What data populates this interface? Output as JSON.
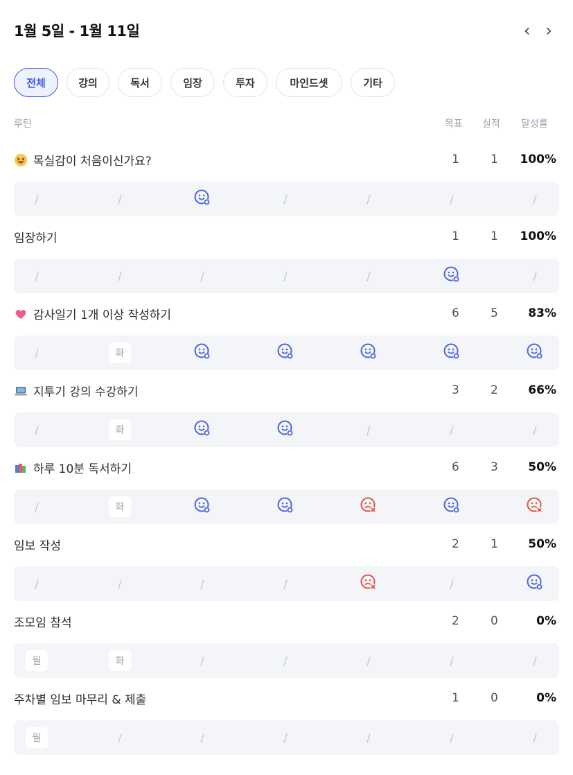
{
  "header": {
    "title": "1월 5일 - 1월 11일",
    "prev": "‹",
    "next": "›"
  },
  "tabs": [
    {
      "label": "전체",
      "active": true
    },
    {
      "label": "강의"
    },
    {
      "label": "독서"
    },
    {
      "label": "임장"
    },
    {
      "label": "투자"
    },
    {
      "label": "마인드셋"
    },
    {
      "label": "기타"
    }
  ],
  "columns": {
    "routine": "루틴",
    "goal": "목표",
    "actual": "실적",
    "rate": "달성률"
  },
  "routines": [
    {
      "emoji": "grinning-squint-face",
      "name": "목실감이 처음이신가요?",
      "goal": "1",
      "actual": "1",
      "rate": "100%",
      "days": [
        "/",
        "/",
        "success",
        "/",
        "/",
        "/",
        "/"
      ]
    },
    {
      "emoji": "",
      "name": "임장하기",
      "goal": "1",
      "actual": "1",
      "rate": "100%",
      "days": [
        "/",
        "/",
        "/",
        "/",
        "/",
        "success",
        "/"
      ]
    },
    {
      "emoji": "pink-heart",
      "name": "감사일기 1개 이상 작성하기",
      "goal": "6",
      "actual": "5",
      "rate": "83%",
      "days": [
        "/",
        "화",
        "success",
        "success",
        "success",
        "success",
        "success"
      ]
    },
    {
      "emoji": "laptop",
      "name": "지투기 강의 수강하기",
      "goal": "3",
      "actual": "2",
      "rate": "66%",
      "days": [
        "/",
        "화",
        "success",
        "success",
        "/",
        "/",
        "/"
      ]
    },
    {
      "emoji": "books",
      "name": "하루 10분 독서하기",
      "goal": "6",
      "actual": "3",
      "rate": "50%",
      "days": [
        "/",
        "화",
        "success",
        "success",
        "fail",
        "success",
        "fail"
      ]
    },
    {
      "emoji": "",
      "name": "임보 작성",
      "goal": "2",
      "actual": "1",
      "rate": "50%",
      "days": [
        "/",
        "/",
        "/",
        "/",
        "fail",
        "/",
        "success"
      ]
    },
    {
      "emoji": "",
      "name": "조모임 참석",
      "goal": "2",
      "actual": "0",
      "rate": "0%",
      "days": [
        "월",
        "화",
        "/",
        "/",
        "/",
        "/",
        "/"
      ]
    },
    {
      "emoji": "",
      "name": "주차별 임보 마무리 & 제출",
      "goal": "1",
      "actual": "0",
      "rate": "0%",
      "days": [
        "월",
        "/",
        "/",
        "/",
        "/",
        "/",
        "/"
      ]
    }
  ],
  "colors": {
    "accent": "#3b5bdb",
    "success": "#4a63e0",
    "fail": "#e0553d",
    "rowBg": "#f4f5f9"
  }
}
